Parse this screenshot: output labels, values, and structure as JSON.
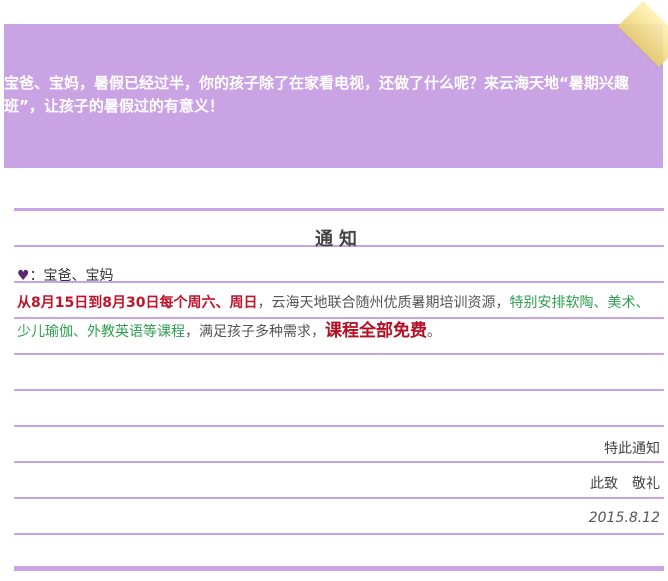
{
  "banner": {
    "text": "宝爸、宝妈，暑假已经过半，你的孩子除了在家看电视，还做了什么呢？来云海天地“暑期兴趣班”，让孩子的暑假过的有意义！"
  },
  "notice": {
    "title": "通知",
    "greeting_heart": "♥",
    "greeting_text": "：宝爸、宝妈",
    "body": {
      "date_range": "从8月15日到8月30日每个周六、周日",
      "part2": "，云海天地联合随州优质暑期培训资源，",
      "courses": "特别安排软陶、美术、少儿瑜伽、外教英语等课程",
      "part4": "，满足孩子多种需求，",
      "free": "课程全部免费",
      "end": "。"
    },
    "sign_off_1": "特此通知",
    "sign_off_2": "此致　敬礼",
    "date": "2015.8.12"
  },
  "colors": {
    "accent_purple": "#c9a3e3",
    "red": "#c0142b",
    "green": "#2e9f4f"
  }
}
